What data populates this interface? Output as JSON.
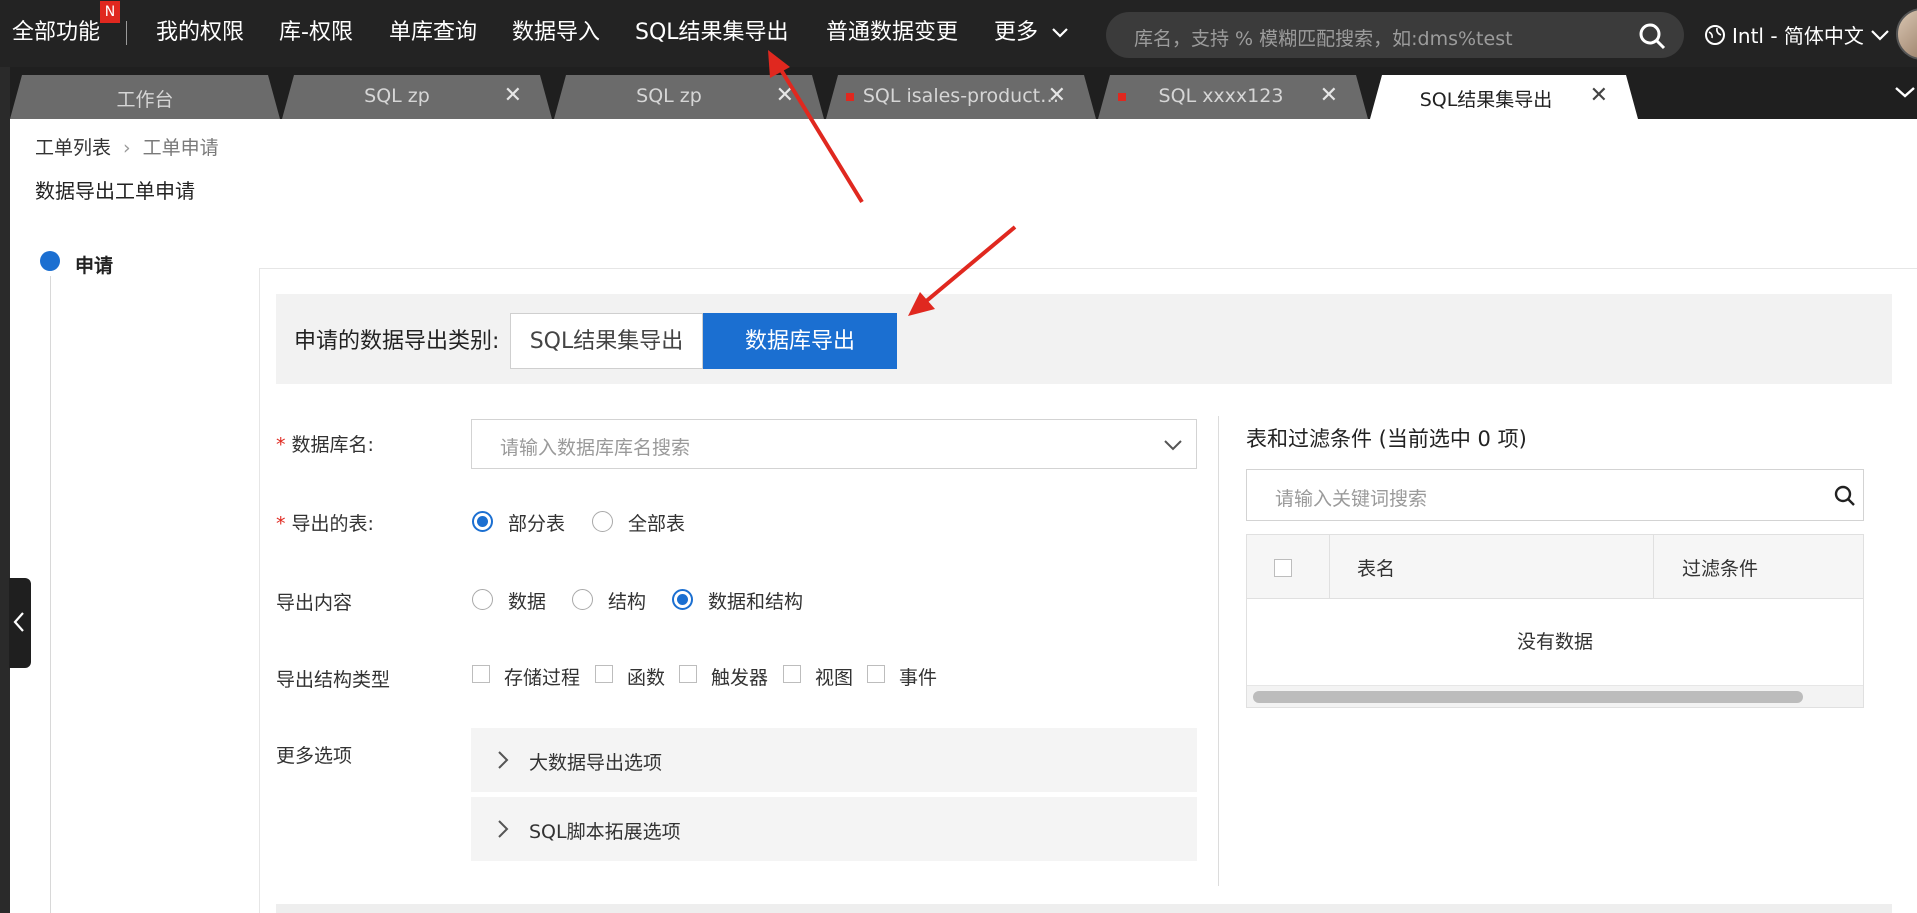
{
  "nav": {
    "items": [
      {
        "label": "全部功能",
        "badge": "N"
      },
      {
        "label": "我的权限"
      },
      {
        "label": "库-权限"
      },
      {
        "label": "单库查询"
      },
      {
        "label": "数据导入"
      },
      {
        "label": "SQL结果集导出"
      },
      {
        "label": "普通数据变更"
      },
      {
        "label": "更多"
      }
    ],
    "search_placeholder": "库名，支持 % 模糊匹配搜索，如:dms%test",
    "language": "Intl - 简体中文"
  },
  "tabs": [
    {
      "label": "工作台",
      "closable": false
    },
    {
      "label": "SQL zp",
      "closable": true
    },
    {
      "label": "SQL zp",
      "closable": true
    },
    {
      "label": "SQL isales-product…",
      "closable": true,
      "modified": true
    },
    {
      "label": "SQL xxxx123",
      "closable": true,
      "modified": true
    },
    {
      "label": "SQL结果集导出",
      "closable": true,
      "active": true
    }
  ],
  "breadcrumb": {
    "parent": "工单列表",
    "current": "工单申请"
  },
  "page_title": "数据导出工单申请",
  "step": {
    "label": "申请"
  },
  "export_type": {
    "label": "申请的数据导出类别:",
    "options": [
      "SQL结果集导出",
      "数据库导出"
    ],
    "selected": "数据库导出"
  },
  "form": {
    "db_name": {
      "label": "数据库名:",
      "placeholder": "请输入数据库库名搜索"
    },
    "tables": {
      "label": "导出的表:",
      "options": [
        "部分表",
        "全部表"
      ],
      "selected": "部分表"
    },
    "content": {
      "label": "导出内容",
      "options": [
        "数据",
        "结构",
        "数据和结构"
      ],
      "selected": "数据和结构"
    },
    "struct_types": {
      "label": "导出结构类型",
      "options": [
        "存储过程",
        "函数",
        "触发器",
        "视图",
        "事件"
      ]
    },
    "more": {
      "label": "更多选项",
      "sections": [
        "大数据导出选项",
        "SQL脚本拓展选项"
      ]
    }
  },
  "right_panel": {
    "title": "表和过滤条件 (当前选中 0 项)",
    "search_placeholder": "请输入关键词搜索",
    "columns": [
      "表名",
      "过滤条件"
    ],
    "empty_text": "没有数据"
  },
  "colors": {
    "accent": "#1b6fd1",
    "nav_bg": "#232323",
    "annotation": "#e0281f"
  }
}
